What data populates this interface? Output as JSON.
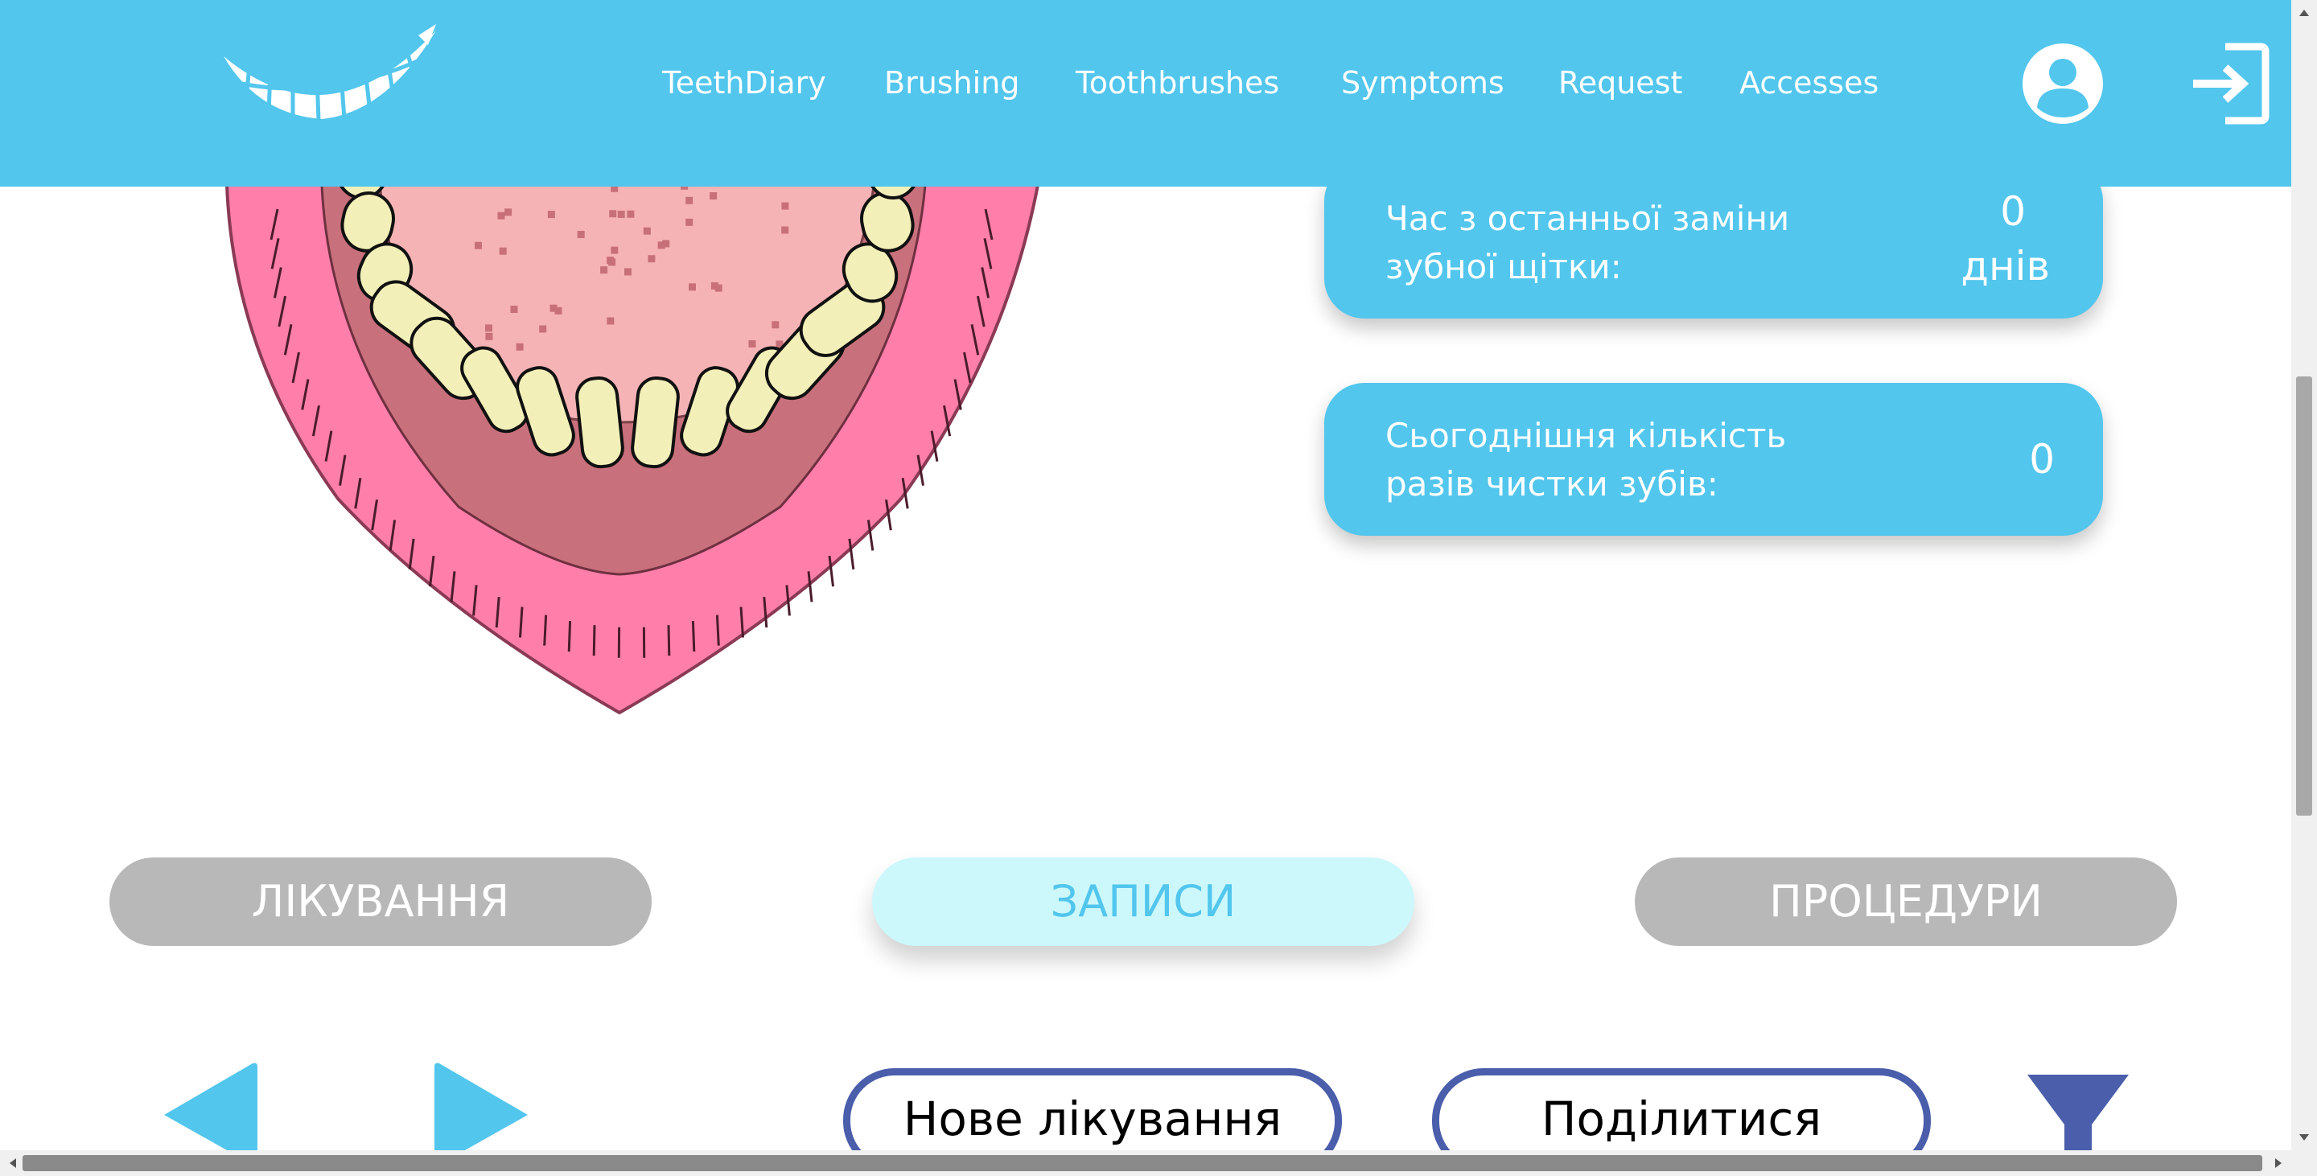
{
  "header": {
    "nav": [
      {
        "label": "TeethDiary"
      },
      {
        "label": "Brushing"
      },
      {
        "label": "Toothbrushes"
      },
      {
        "label": "Symptoms"
      },
      {
        "label": "Request"
      },
      {
        "label": "Accesses"
      }
    ],
    "icons": {
      "logo": "smile-teeth-logo",
      "user": "user-circle-icon",
      "logout": "sign-out-icon"
    }
  },
  "stats": {
    "toothbrush_change": {
      "label": "Час з останньої заміни зубної щітки:",
      "value": "0",
      "unit": "днів"
    },
    "brushing_today": {
      "label": "Сьогоднішня кількість разів чистки зубів:",
      "value": "0"
    }
  },
  "tabs": [
    {
      "label": "ЛІКУВАННЯ",
      "active": false
    },
    {
      "label": "ЗАПИСИ",
      "active": true
    },
    {
      "label": "ПРОЦЕДУРИ",
      "active": false
    }
  ],
  "actions": {
    "new_treatment": "Нове лікування",
    "share": "Поділитися"
  },
  "colors": {
    "primary": "#52c6ed",
    "active_tab_bg": "#ccf8fc",
    "inactive_tab_bg": "#b8b8b8",
    "button_border": "#4a5eab",
    "gum_pink": "#ff7faa",
    "tooth": "#f2f0b8"
  }
}
